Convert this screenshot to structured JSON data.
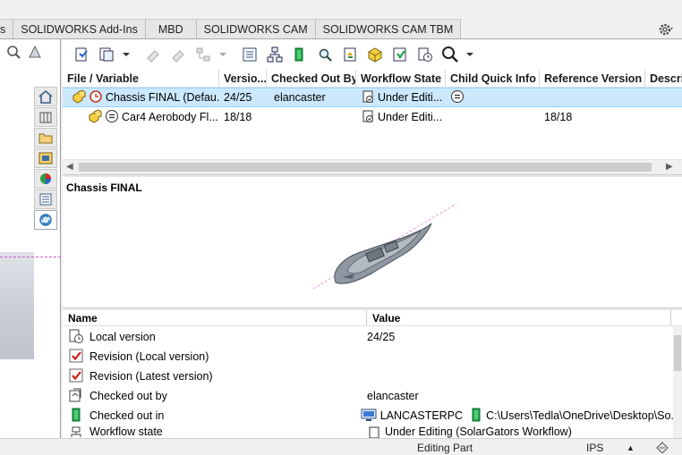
{
  "tabs": [
    {
      "label": "s"
    },
    {
      "label": "SOLIDWORKS Add-Ins"
    },
    {
      "label": "MBD"
    },
    {
      "label": "SOLIDWORKS CAM"
    },
    {
      "label": "SOLIDWORKS CAM TBM"
    }
  ],
  "file_grid": {
    "columns": [
      "File / Variable",
      "Versio...",
      "Checked Out By",
      "Workflow State",
      "Child Quick Info",
      "Reference Version",
      "Descri"
    ],
    "rows": [
      {
        "name": "Chassis FINAL  (Defau...",
        "version": "24/25",
        "checked_out_by": "elancaster",
        "workflow_state": "Under Editi...",
        "reference_version": ""
      },
      {
        "name": "Car4 Aerobody Fl...",
        "version": "18/18",
        "checked_out_by": "",
        "workflow_state": "Under Editi...",
        "reference_version": "18/18"
      }
    ]
  },
  "preview": {
    "title": "Chassis FINAL"
  },
  "properties": {
    "columns": [
      "Name",
      "Value"
    ],
    "rows": [
      {
        "name": "Local version",
        "value": "24/25"
      },
      {
        "name": "Revision (Local version)",
        "value": ""
      },
      {
        "name": "Revision (Latest version)",
        "value": ""
      },
      {
        "name": "Checked out by",
        "value": "elancaster"
      },
      {
        "name": "Checked out in",
        "value_computer": "LANCASTERPC",
        "value_path": "C:\\Users\\Tedla\\OneDrive\\Desktop\\So..."
      },
      {
        "name": "Workflow state",
        "value": "Under Editing (SolarGators Workflow)"
      }
    ]
  },
  "status": {
    "mode": "Editing Part",
    "units": "IPS",
    "arrow": "▲"
  },
  "colors": {
    "selection": "#cce8ff",
    "accent": "#0078d7",
    "check_red": "#d01a1a"
  }
}
